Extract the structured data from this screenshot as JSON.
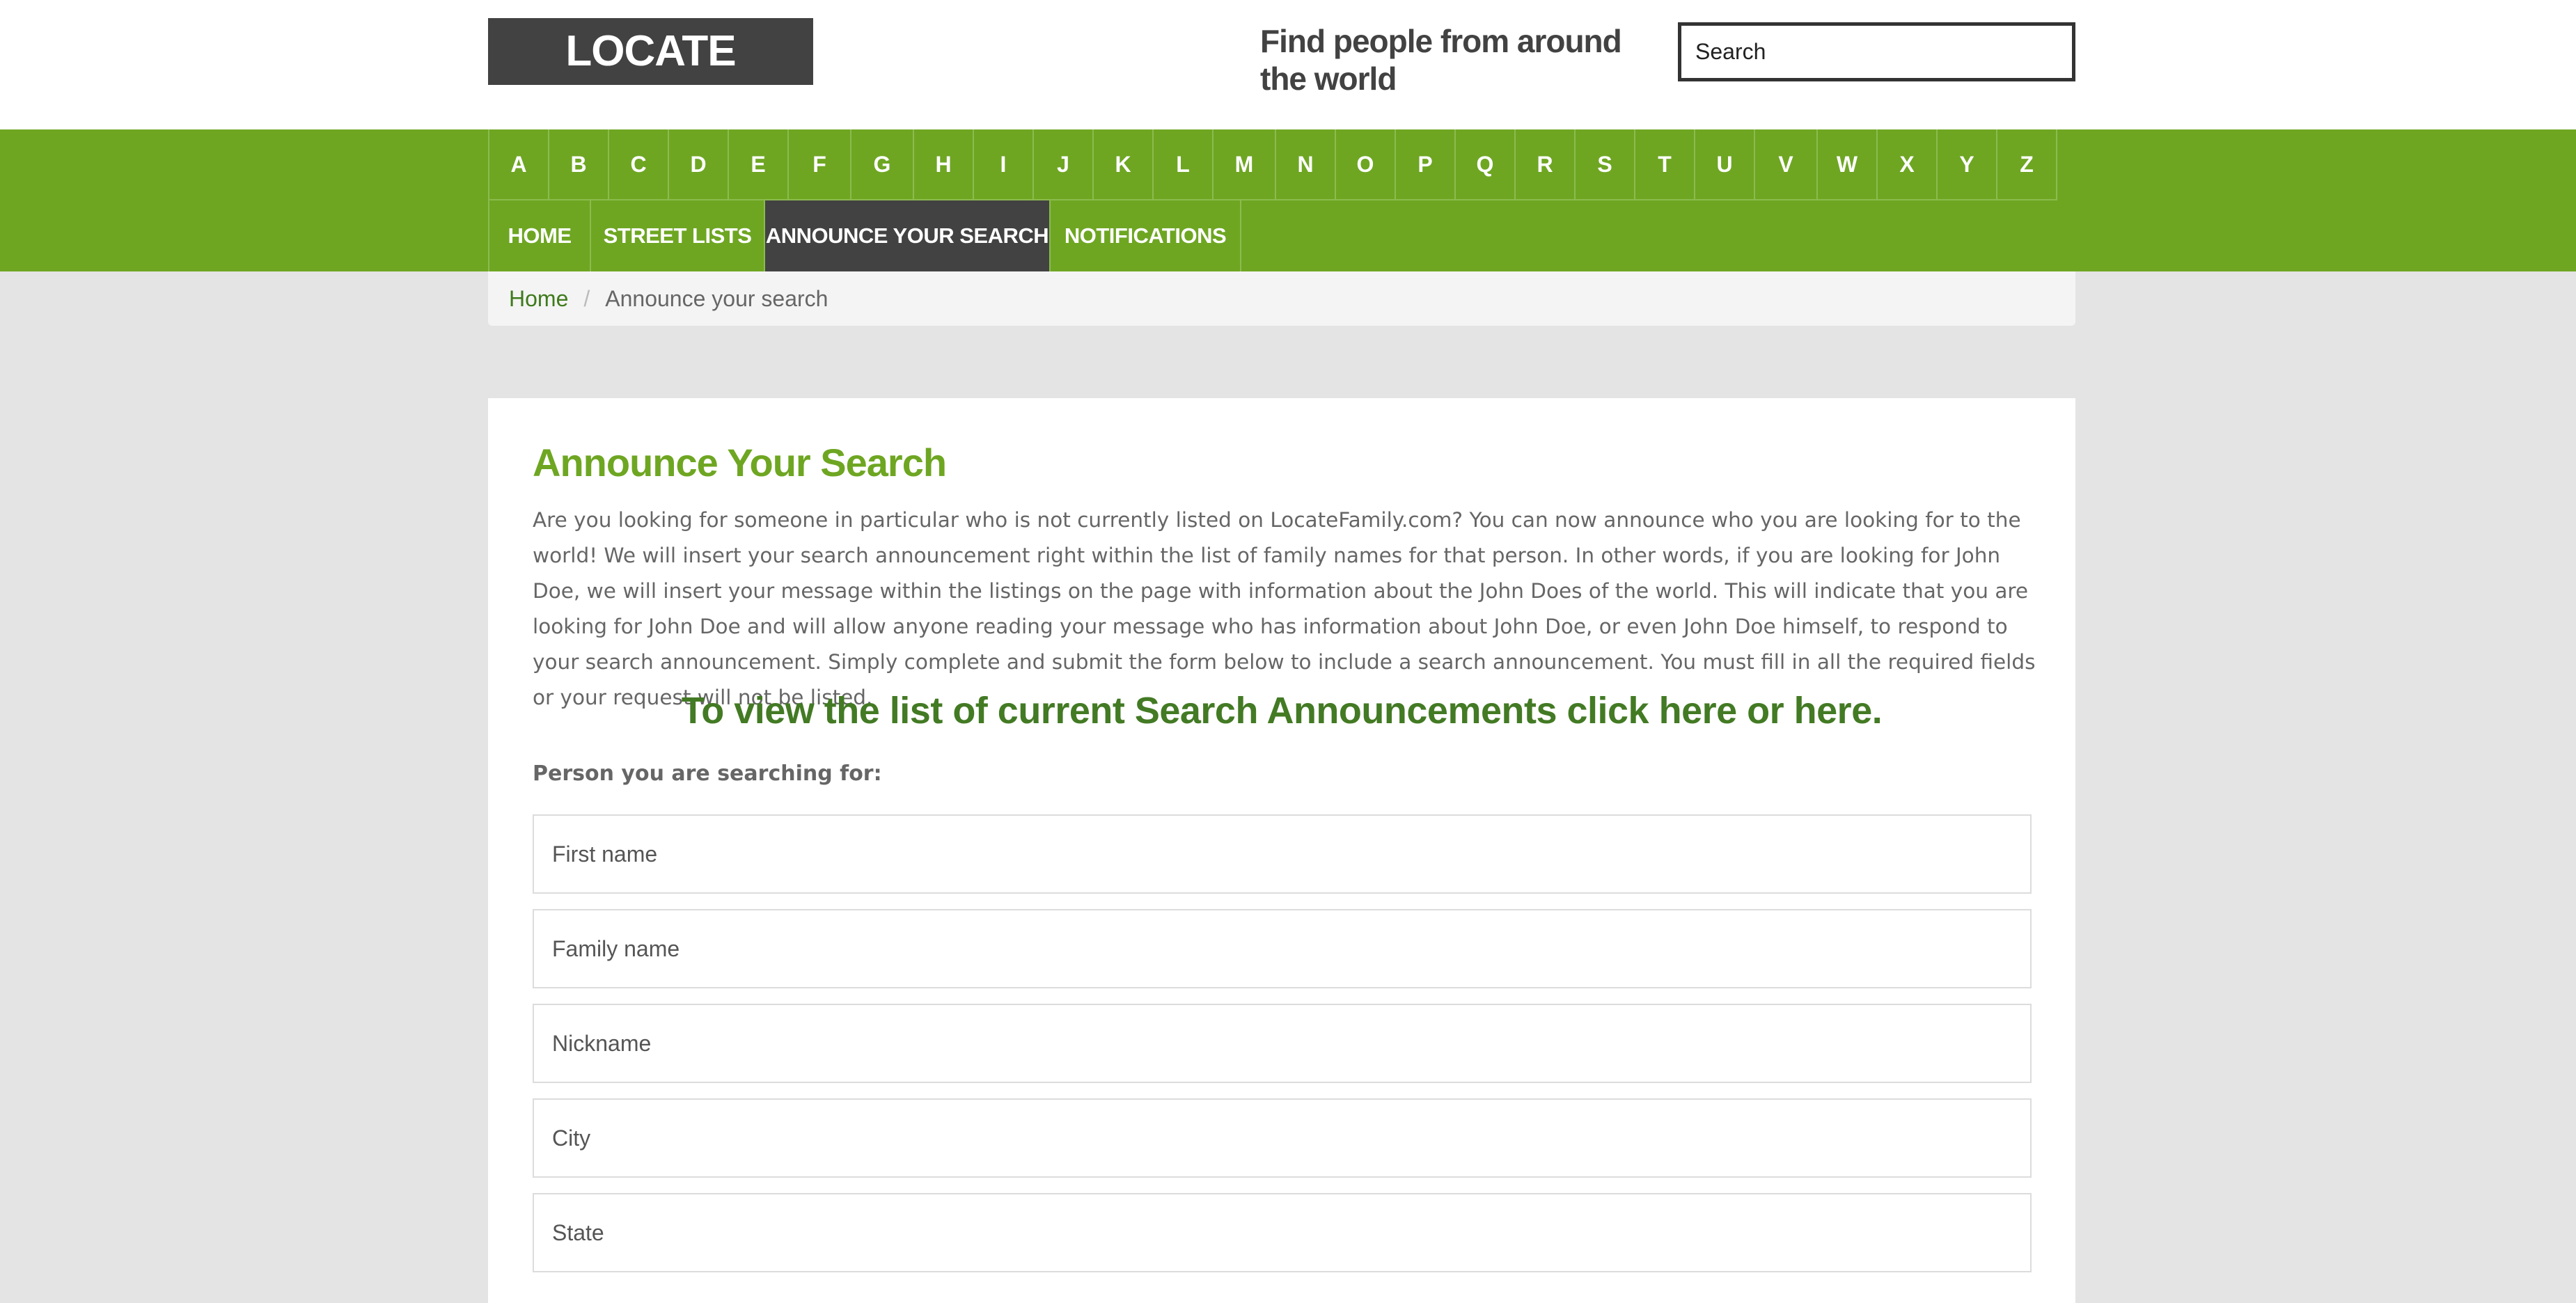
{
  "header": {
    "logo": "LOCATE FAMILY",
    "tagline": "Find people from around the world",
    "search_placeholder": "Search"
  },
  "alphabet": [
    "A",
    "B",
    "C",
    "D",
    "E",
    "F",
    "G",
    "H",
    "I",
    "J",
    "K",
    "L",
    "M",
    "N",
    "O",
    "P",
    "Q",
    "R",
    "S",
    "T",
    "U",
    "V",
    "W",
    "X",
    "Y",
    "Z"
  ],
  "menu": [
    {
      "label": "HOME",
      "active": false
    },
    {
      "label": "STREET LISTS",
      "active": false
    },
    {
      "label": "ANNOUNCE YOUR SEARCH",
      "active": true
    },
    {
      "label": "NOTIFICATIONS",
      "active": false
    }
  ],
  "breadcrumb": {
    "home": "Home",
    "separator": "/",
    "current": "Announce your search"
  },
  "main": {
    "title": "Announce Your Search",
    "intro": "Are you looking for someone in particular who is not currently listed on LocateFamily.com? You can now announce who you are looking for to the world! We will insert your search announcement right within the list of family names for that person. In other words, if you are looking for John Doe, we will insert your message within the listings on the page with information about the John Does of the world. This will indicate that you are looking for John Doe and will allow anyone reading your message who has information about John Doe, or even John Doe himself, to respond to your search announcement. Simply complete and submit the form below to include a search announcement. You must fill in all the required fields or your request will not be listed.",
    "view_link": "To view the list of current Search Announcements click here or here.",
    "form_label": "Person you are searching for:",
    "fields": [
      {
        "placeholder": "First name"
      },
      {
        "placeholder": "Family name"
      },
      {
        "placeholder": "Nickname"
      },
      {
        "placeholder": "City"
      },
      {
        "placeholder": "State"
      }
    ]
  },
  "colors": {
    "brand_green": "#6ea622",
    "link_green": "#437a24",
    "dark": "#424242",
    "page_bg": "#e4e4e4"
  }
}
